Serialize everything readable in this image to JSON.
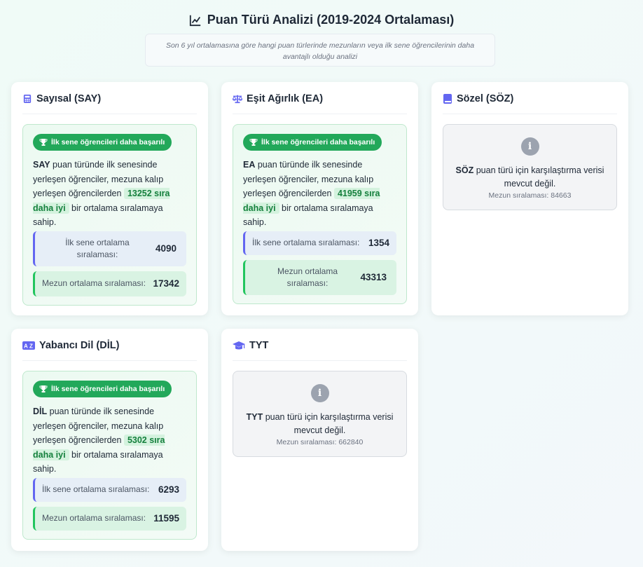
{
  "header": {
    "title": "Puan Türü Analizi (2019-2024 Ortalaması)",
    "subtitle": "Son 6 yıl ortalamasına göre hangi puan türlerinde mezunların veya ilk sene öğrencilerinin daha avantajlı olduğu analizi"
  },
  "cards": {
    "say": {
      "title": "Sayısal (SAY)",
      "badge": "İlk sene öğrencileri daha başarılı",
      "code": "SAY",
      "text_before": "puan türünde ilk senesinde yerleşen öğrenciler, mezuna kalıp yerleşen öğrencilerden",
      "highlight": "13252 sıra daha iyi",
      "text_after": "bir ortalama sıralamaya sahip.",
      "first_label": "İlk sene ortalama sıralaması:",
      "first_value": "4090",
      "grad_label": "Mezun ortalama sıralaması:",
      "grad_value": "17342"
    },
    "ea": {
      "title": "Eşit Ağırlık (EA)",
      "badge": "İlk sene öğrencileri daha başarılı",
      "code": "EA",
      "text_before": "puan türünde ilk senesinde yerleşen öğrenciler, mezuna kalıp yerleşen öğrencilerden",
      "highlight": "41959 sıra daha iyi",
      "text_after": "bir ortalama sıralamaya sahip.",
      "first_label": "İlk sene ortalama sıralaması:",
      "first_value": "1354",
      "grad_label": "Mezun ortalama sıralaması:",
      "grad_value": "43313"
    },
    "soz": {
      "title": "Sözel (SÖZ)",
      "code": "SÖZ",
      "message": "puan türü için karşılaştırma verisi mevcut değil.",
      "sub": "Mezun sıralaması: 84663"
    },
    "dil": {
      "title": "Yabancı Dil (DİL)",
      "badge": "İlk sene öğrencileri daha başarılı",
      "code": "DİL",
      "text_before": "puan türünde ilk senesinde yerleşen öğrenciler, mezuna kalıp yerleşen öğrencilerden",
      "highlight": "5302 sıra daha iyi",
      "text_after": "bir ortalama sıralamaya sahip.",
      "first_label": "İlk sene ortalama sıralaması:",
      "first_value": "6293",
      "grad_label": "Mezun ortalama sıralaması:",
      "grad_value": "11595"
    },
    "tyt": {
      "title": "TYT",
      "code": "TYT",
      "message": "puan türü için karşılaştırma verisi mevcut değil.",
      "sub": "Mezun sıralaması: 662840"
    }
  },
  "colors": {
    "success": "#22a85a",
    "highlight_text": "#15803d",
    "accent_blue": "#6366f1",
    "accent_green": "#22c55e",
    "icon_purple": "#6366f1"
  }
}
